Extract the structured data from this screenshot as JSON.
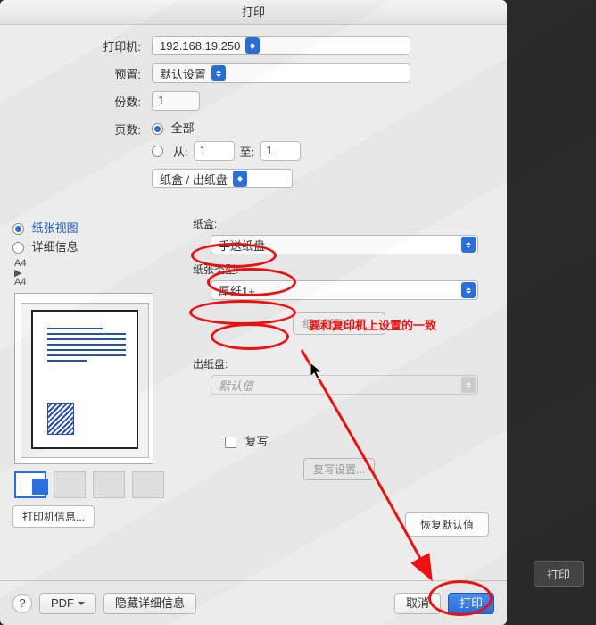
{
  "dialog": {
    "title": "打印",
    "printer_label": "打印机:",
    "printer_value": "192.168.19.250",
    "preset_label": "预置:",
    "preset_value": "默认设置",
    "copies_label": "份数:",
    "copies_value": "1",
    "pages_label": "页数:",
    "pages_all": "全部",
    "pages_from": "从:",
    "pages_from_value": "1",
    "pages_to": "至:",
    "pages_to_value": "1",
    "section_select": "纸盒 / 出纸盘"
  },
  "left": {
    "view_paper": "纸张视图",
    "view_detail": "详细信息",
    "size": "A4",
    "arrow": "▶",
    "size2": "A4",
    "printer_info": "打印机信息..."
  },
  "right": {
    "tray_label": "纸盒:",
    "tray_value": "手送纸盘",
    "papertype_label": "纸张类型:",
    "papertype_value": "厚纸1+",
    "tray_settings": "纸盒纸张设置...",
    "output_label": "出纸盘:",
    "output_value": "默认值",
    "carbon_label": "复写",
    "carbon_settings": "复写设置...",
    "restore_defaults": "恢复默认值"
  },
  "bottom": {
    "help": "?",
    "pdf": "PDF",
    "hide_details": "隐藏详细信息",
    "cancel": "取消",
    "print": "打印"
  },
  "behind": {
    "print": "打印"
  },
  "annotations": {
    "note": "要和复印机上设置的一致"
  }
}
